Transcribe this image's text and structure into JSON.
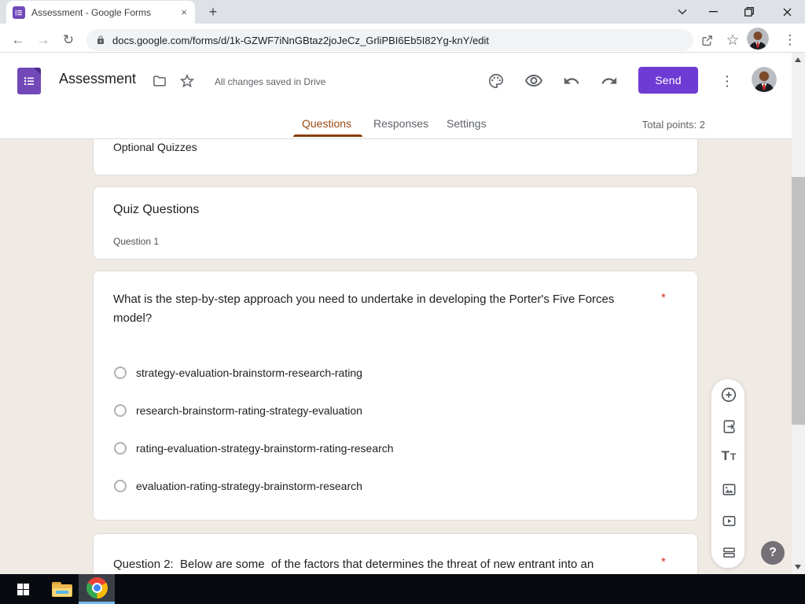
{
  "browser": {
    "tab": {
      "title": "Assessment - Google Forms",
      "close_glyph": "×"
    },
    "new_tab_glyph": "+",
    "toolbar": {
      "back_glyph": "←",
      "forward_glyph": "→",
      "reload_glyph": "↻",
      "url": "docs.google.com/forms/d/1k-GZWF7iNnGBtaz2joJeCz_GrliPBI6Eb5I82Yg-knY/edit",
      "star_glyph": "☆",
      "menu_glyph": "⋮"
    }
  },
  "forms_header": {
    "title": "Assessment",
    "saved_status": "All changes saved in Drive",
    "send_button": "Send",
    "menu_glyph": "⋮"
  },
  "nav": {
    "tabs": [
      "Questions",
      "Responses",
      "Settings"
    ],
    "active_tab": "Questions",
    "total_points": "Total points: 2"
  },
  "form": {
    "top_section_title": "Optional Quizzes",
    "section": {
      "title": "Quiz Questions",
      "description": "Question 1"
    },
    "question1": {
      "text": "What is the step-by-step approach you need to undertake in developing the Porter's Five Forces model?",
      "required_marker": "*",
      "options": [
        "strategy-evaluation-brainstorm-research-rating",
        "research-brainstorm-rating-strategy-evaluation",
        "rating-evaluation-strategy-brainstorm-rating-research",
        "evaluation-rating-strategy-brainstorm-research"
      ]
    },
    "question2_preview": {
      "text": "Question 2:  Below are some  of the factors that determines the threat of new entrant into an",
      "required_marker": "*"
    }
  },
  "side_toolbar": {
    "tt_large": "T",
    "tt_small": "T"
  },
  "help_button": "?",
  "colors": {
    "brand_purple": "#7248b9",
    "send_button_purple": "#6e3bd4",
    "active_tab_brown": "#9c4a10",
    "page_background": "#f0eae4",
    "required_red": "#d93025",
    "taskbar_accent_blue": "#76b9ed"
  }
}
